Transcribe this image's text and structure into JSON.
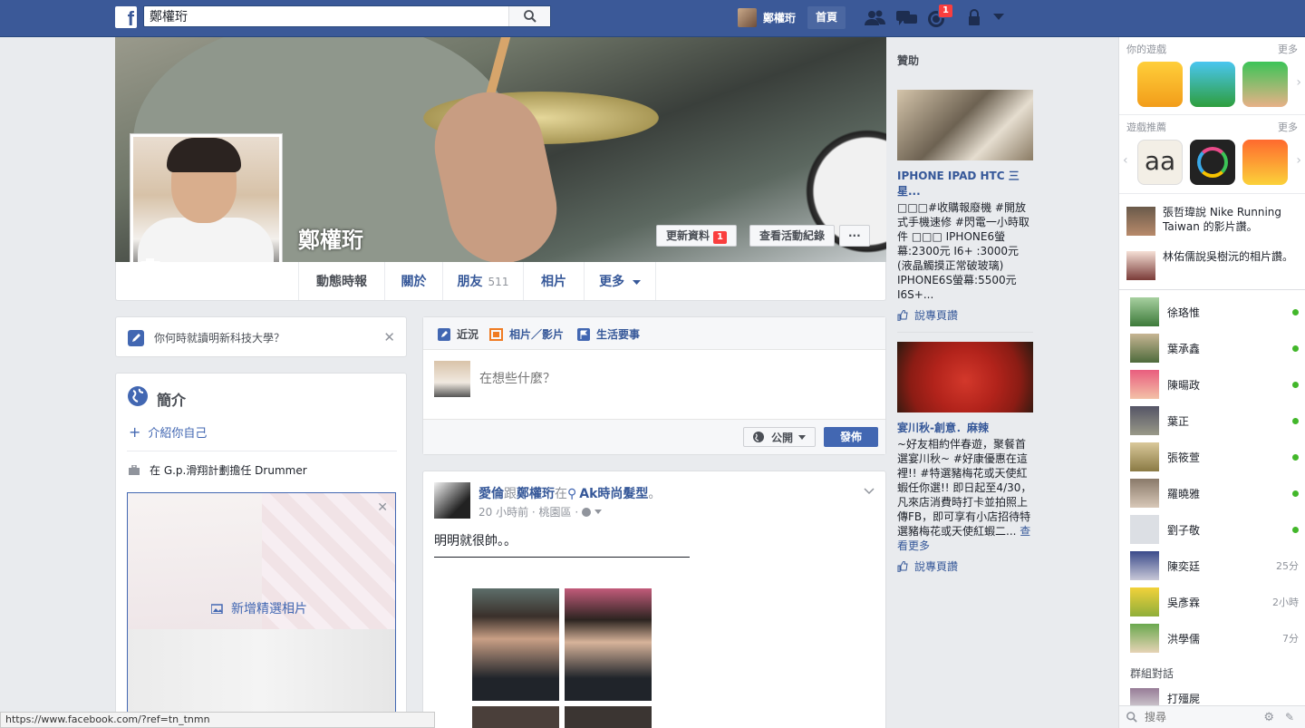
{
  "topbar": {
    "logo": "f",
    "search_value": "鄭權珩",
    "user_name": "鄭權珩",
    "home_label": "首頁",
    "notification_count": "1"
  },
  "profile": {
    "name": "鄭權珩",
    "update_info_label": "更新資料",
    "update_badge": "1",
    "activity_log_label": "查看活動紀錄",
    "more_dots": "···"
  },
  "tabs": [
    {
      "label": "動態時報"
    },
    {
      "label": "關於"
    },
    {
      "label": "朋友",
      "count": "511"
    },
    {
      "label": "相片"
    },
    {
      "label": "更多"
    }
  ],
  "prompt": {
    "text": "你何時就讀明新科技大學？"
  },
  "intro": {
    "title": "簡介",
    "add_bio": "介紹你自己",
    "work": "在 G.p.滑翔計劃擔任 Drummer",
    "add_featured": "新增精選相片"
  },
  "composer": {
    "tabs": [
      "近況",
      "相片／影片",
      "生活要事"
    ],
    "placeholder": "在想些什麼？",
    "privacy": "公開",
    "post_button": "發佈"
  },
  "post": {
    "author": "愛倫",
    "with_text": "跟",
    "tagged": "鄭權珩",
    "at_text": "在",
    "place": "Ak時尚髮型",
    "end": "。",
    "time": "20 小時前 · 桃園區 ·",
    "body": "明明就很帥。。"
  },
  "sponsored": {
    "heading": "贊助",
    "ads": [
      {
        "title": "IPHONE IPAD HTC 三星...",
        "text": "□□□#收購報廢機 #開放式手機速修 #閃電一小時取件 □□□ IPHONE6螢幕:2300元 I6+ :3000元(液晶觸摸正常破玻璃) IPHONE6S螢幕:5500元 I6S+...",
        "like": "說專頁讚"
      },
      {
        "title": "宴川秋-創意．麻辣",
        "text": "~好友相約伴春遊，聚餐首選宴川秋~ #好康優惠在這裡!! #特選豬梅花或天使紅蝦任你選!! 即日起至4/30，凡來店消費時打卡並拍照上傳FB，即可享有小店招待特選豬梅花或天使紅蝦二...",
        "see_more": "查看更多",
        "like": "說專頁讚"
      }
    ]
  },
  "chat": {
    "games_heading": "你的遊戲",
    "games_more": "更多",
    "rec_heading": "遊戲推薦",
    "rec_more": "更多",
    "stories": [
      {
        "text": "張哲瑋說 Nike Running Taiwan 的影片讚。"
      },
      {
        "text": "林佑儒說吳樹沅的相片讚。"
      }
    ],
    "friends": [
      {
        "name": "徐珞惟",
        "status": "online"
      },
      {
        "name": "葉承鑫",
        "status": "online"
      },
      {
        "name": "陳暘政",
        "status": "online"
      },
      {
        "name": "葉正",
        "status": "online"
      },
      {
        "name": "張筱萱",
        "status": "online"
      },
      {
        "name": "羅曉雅",
        "status": "online"
      },
      {
        "name": "劉子敬",
        "status": "online"
      },
      {
        "name": "陳奕廷",
        "time": "25分"
      },
      {
        "name": "吳彥霖",
        "time": "2小時"
      },
      {
        "name": "洪學儒",
        "time": "7分"
      }
    ],
    "group_heading": "群組對話",
    "group_name": "打殭屍",
    "search_placeholder": "搜尋"
  },
  "status_url": "https://www.facebook.com/?ref=tn_tnmn",
  "colors": {
    "brand": "#3b5998",
    "link": "#365899",
    "online": "#42b72a",
    "badge": "#fa3e3e"
  }
}
